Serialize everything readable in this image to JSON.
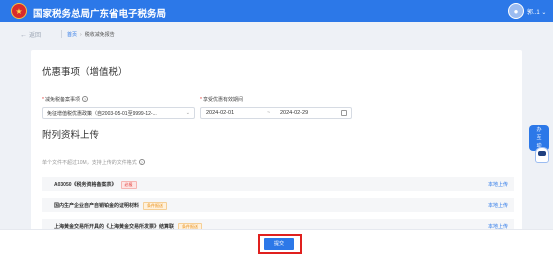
{
  "header": {
    "title": "国家税务总局广东省电子税务局",
    "emblem_icon": "national-emblem-icon",
    "user_name": "郭..1",
    "user_chevron": "⌄",
    "accent_color": "#2c78e8"
  },
  "breadcrumb": {
    "back_label": "返回",
    "home": "首页",
    "separator": "›",
    "current": "税收减免报告"
  },
  "preferential": {
    "title": "优惠事项（增值税）",
    "item_label": "减免税备案事项",
    "item_value": "免征增值税优惠政策（自2003-05-01至9999-12-...",
    "period_label": "享受优惠有效期间",
    "date_start": "2024-02-01",
    "date_sep": "~",
    "date_end": "2024-02-29"
  },
  "attachments": {
    "title": "附列资料上传",
    "hint": "单个文件不超过10M，支持上传的文件格式",
    "rows": [
      {
        "name": "A03050《税务资格备案表》",
        "tag": "必报",
        "action": "本地上传"
      },
      {
        "name": "国内生产企业自产自销铂金的证明材料",
        "tag": "条件报送",
        "action": "本地上传"
      },
      {
        "name": "上海黄金交易所开具的《上海黄金交易所发票》结算联",
        "tag": "条件报送",
        "action": "本地上传"
      }
    ]
  },
  "footer": {
    "submit_label": "提交",
    "highlight_color": "#e0201e"
  },
  "assistant": {
    "line1": "办",
    "line2": "互",
    "line3": "动"
  }
}
